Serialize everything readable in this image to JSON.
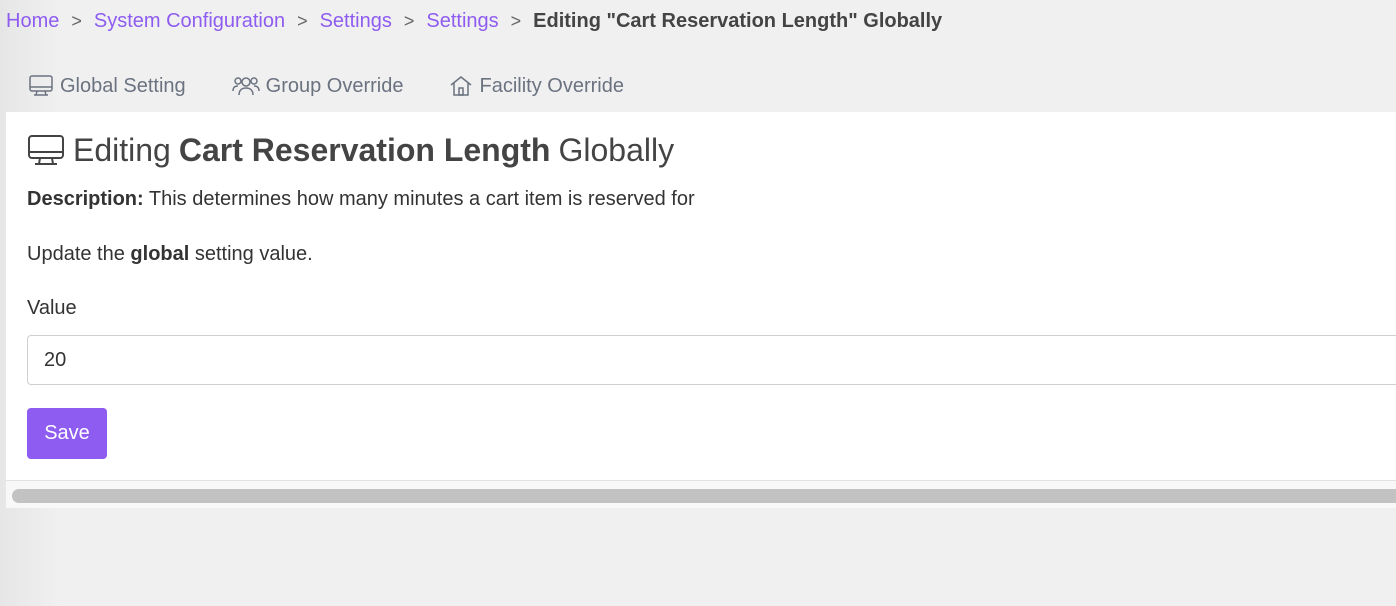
{
  "breadcrumb": {
    "items": [
      "Home",
      "System Configuration",
      "Settings",
      "Settings"
    ],
    "separator": ">",
    "current": "Editing \"Cart Reservation Length\" Globally"
  },
  "tabs": [
    {
      "label": "Global Setting",
      "icon": "monitor-icon"
    },
    {
      "label": "Group Override",
      "icon": "users-icon"
    },
    {
      "label": "Facility Override",
      "icon": "house-icon"
    }
  ],
  "panel": {
    "title_prefix": "Editing",
    "title_setting": "Cart Reservation Length",
    "title_suffix": "Globally",
    "description_label": "Description:",
    "description_text": "This determines how many minutes a cart item is reserved for",
    "update_prefix": "Update the",
    "update_bold": "global",
    "update_suffix": "setting value.",
    "value_label": "Value",
    "value": "20",
    "save_label": "Save"
  },
  "colors": {
    "accent": "#8e5cf0",
    "text": "#444444",
    "muted": "#6b7280"
  }
}
